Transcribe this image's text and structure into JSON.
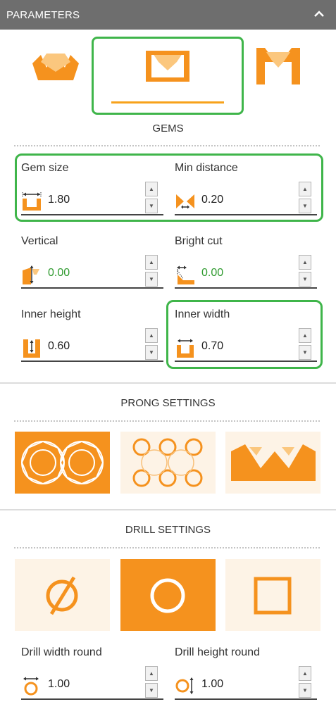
{
  "header": {
    "title": "PARAMETERS"
  },
  "gems": {
    "section_title": "GEMS",
    "types": [
      {
        "name": "flat-setting-icon",
        "selected": false
      },
      {
        "name": "bezel-setting-icon",
        "selected": true
      },
      {
        "name": "channel-setting-icon",
        "selected": false
      }
    ],
    "params": {
      "gem_size": {
        "label": "Gem size",
        "value": "1.80"
      },
      "min_distance": {
        "label": "Min distance",
        "value": "0.20"
      },
      "vertical": {
        "label": "Vertical",
        "value": "0.00"
      },
      "bright_cut": {
        "label": "Bright cut",
        "value": "0.00"
      },
      "inner_height": {
        "label": "Inner height",
        "value": "0.60"
      },
      "inner_width": {
        "label": "Inner width",
        "value": "0.70"
      }
    }
  },
  "prong": {
    "section_title": "PRONG SETTINGS",
    "options": [
      {
        "name": "prong-round-gems",
        "selected": true
      },
      {
        "name": "prong-circles-pattern",
        "selected": false
      },
      {
        "name": "prong-wave-pattern",
        "selected": false
      }
    ]
  },
  "drill": {
    "section_title": "DRILL SETTINGS",
    "options": [
      {
        "name": "drill-diameter",
        "selected": false
      },
      {
        "name": "drill-round",
        "selected": true
      },
      {
        "name": "drill-square",
        "selected": false
      }
    ],
    "params": {
      "width_round": {
        "label": "Drill width round",
        "value": "1.00"
      },
      "height_round": {
        "label": "Drill height round",
        "value": "1.00"
      }
    }
  },
  "colors": {
    "accent": "#f5921e",
    "highlight": "#3fb54a",
    "header": "#6e6e6e",
    "value_green": "#2e9a2e"
  }
}
